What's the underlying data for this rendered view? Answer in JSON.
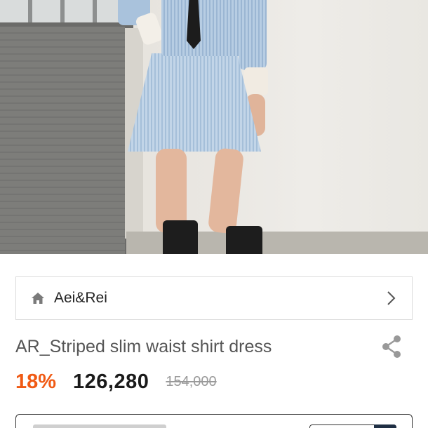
{
  "product_image": {
    "alt_icon": "product-photo"
  },
  "brand": {
    "name": "Aei&Rei",
    "icon": "home-icon",
    "nav_icon": "chevron-right-icon"
  },
  "product": {
    "title": "AR_Striped slim waist shirt dress",
    "share_icon": "share-icon"
  },
  "pricing": {
    "discount": "18%",
    "price": "126,280",
    "original_price": "154,000"
  },
  "colors": {
    "discount": "#f05a14",
    "price": "#1a1a1a",
    "original_price": "#9a9a9a",
    "border": "#dcdcdc"
  }
}
